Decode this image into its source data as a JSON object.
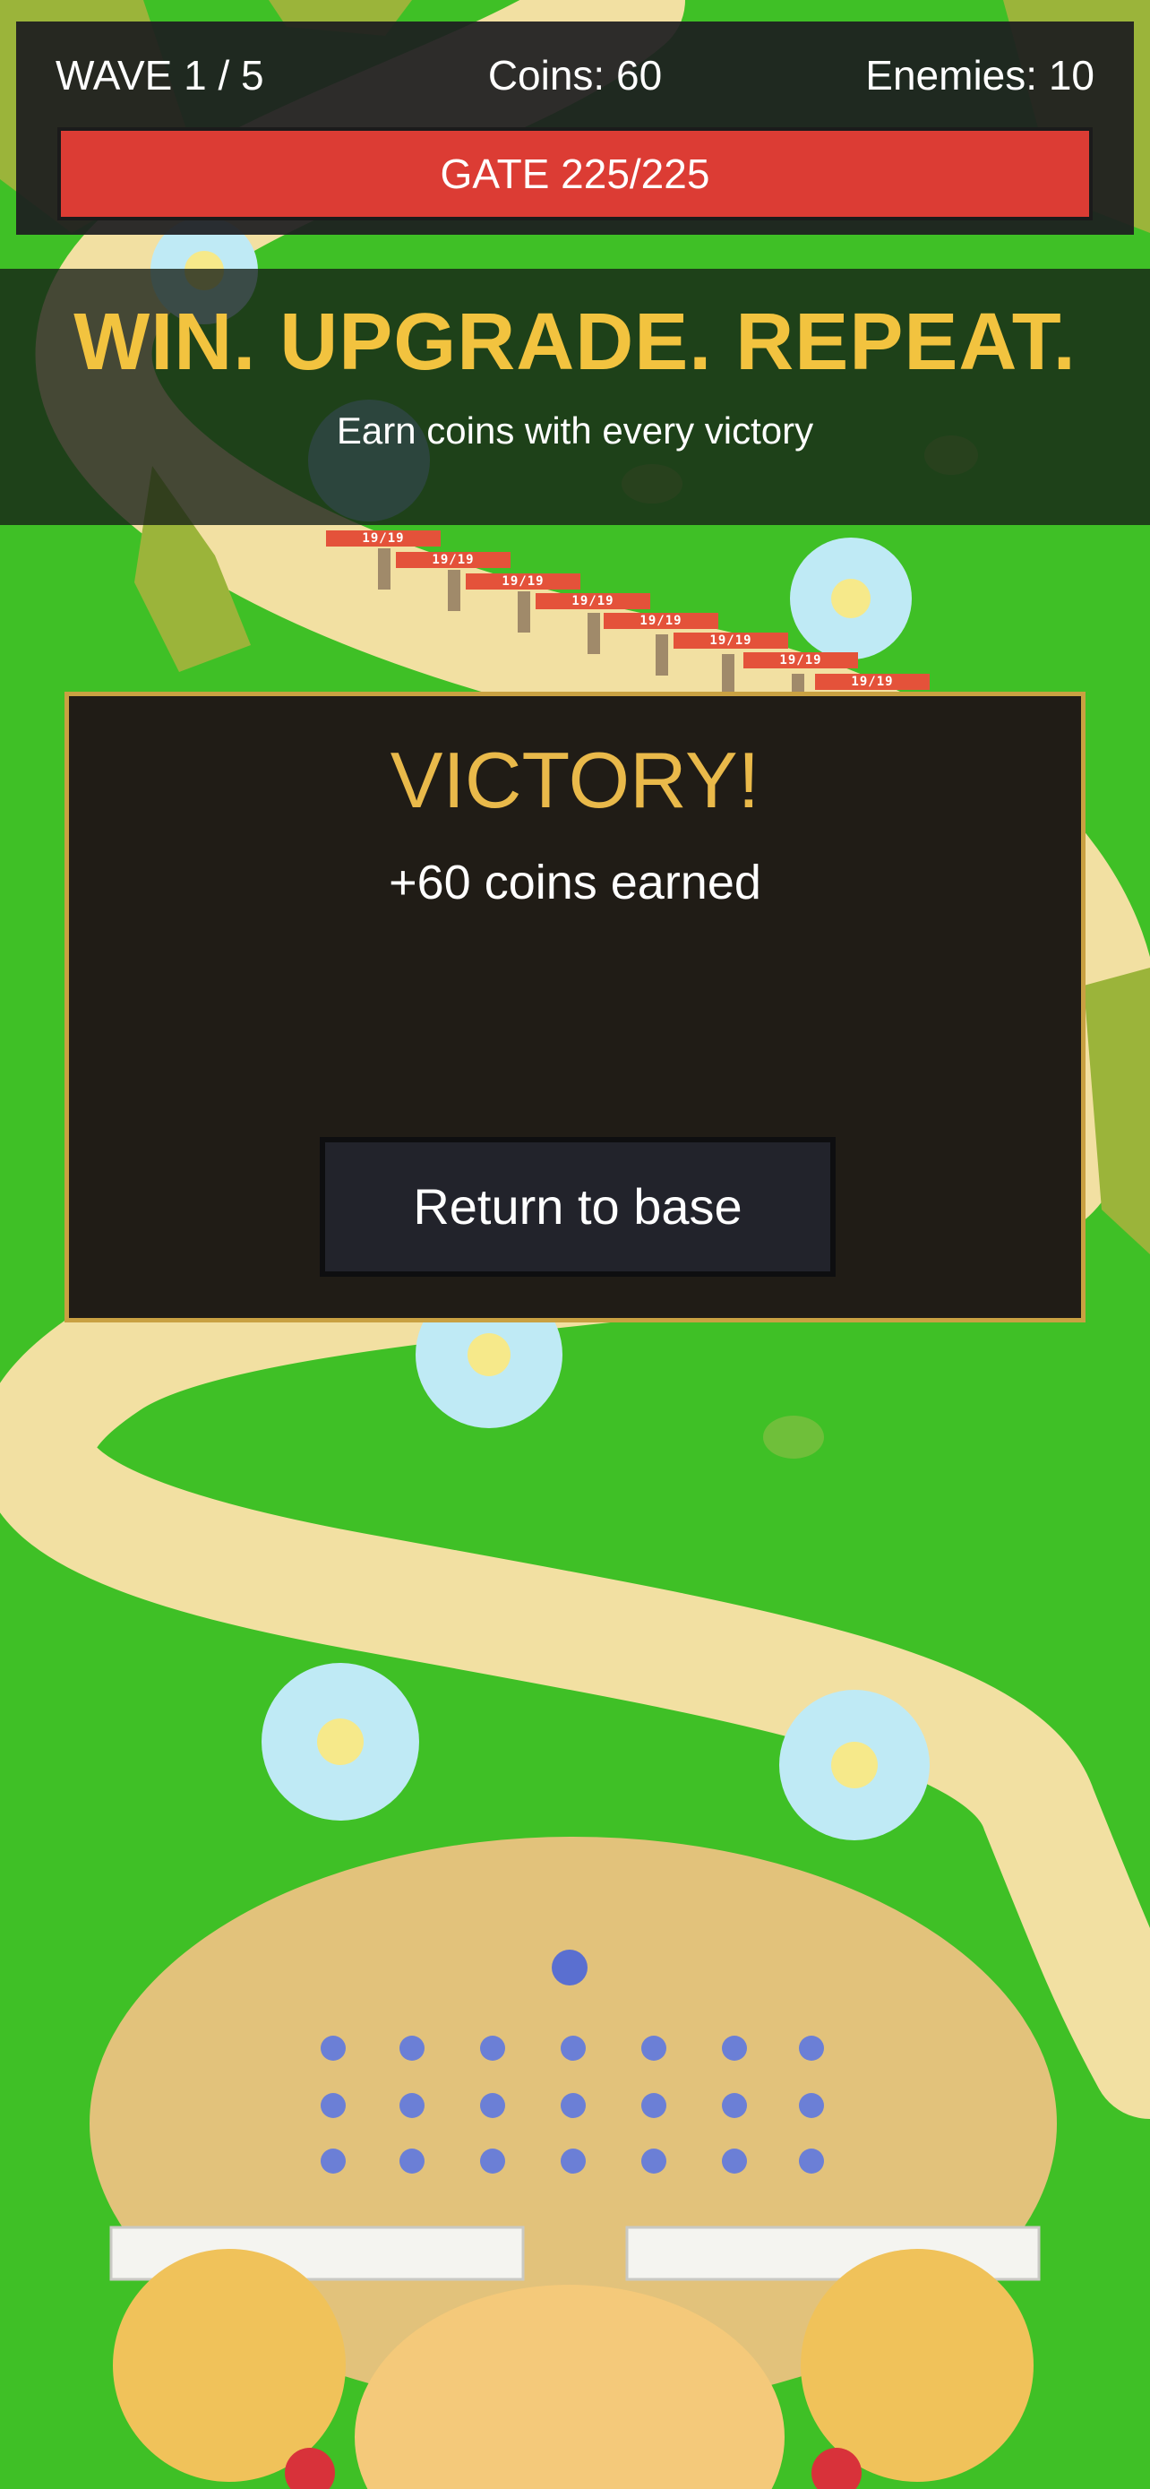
{
  "hud": {
    "wave_label": "WAVE 1 / 5",
    "coins_label": "Coins: 60",
    "enemies_label": "Enemies: 10",
    "gate_label": "GATE 225/225",
    "gate_health_fraction": 1.0,
    "gate_color": "#dc3c34"
  },
  "banner": {
    "title": "WIN. UPGRADE. REPEAT.",
    "subtitle": "Earn coins with every victory",
    "title_color": "#f2c33f"
  },
  "victory_dialog": {
    "title": "VICTORY!",
    "reward_text": "+60 coins earned",
    "return_button": "Return to base",
    "accent_color": "#c9a142"
  },
  "enemy_health_labels": [
    "19/19",
    "19/19",
    "19/19",
    "19/19",
    "19/19",
    "19/19",
    "19/19",
    "19/19"
  ]
}
